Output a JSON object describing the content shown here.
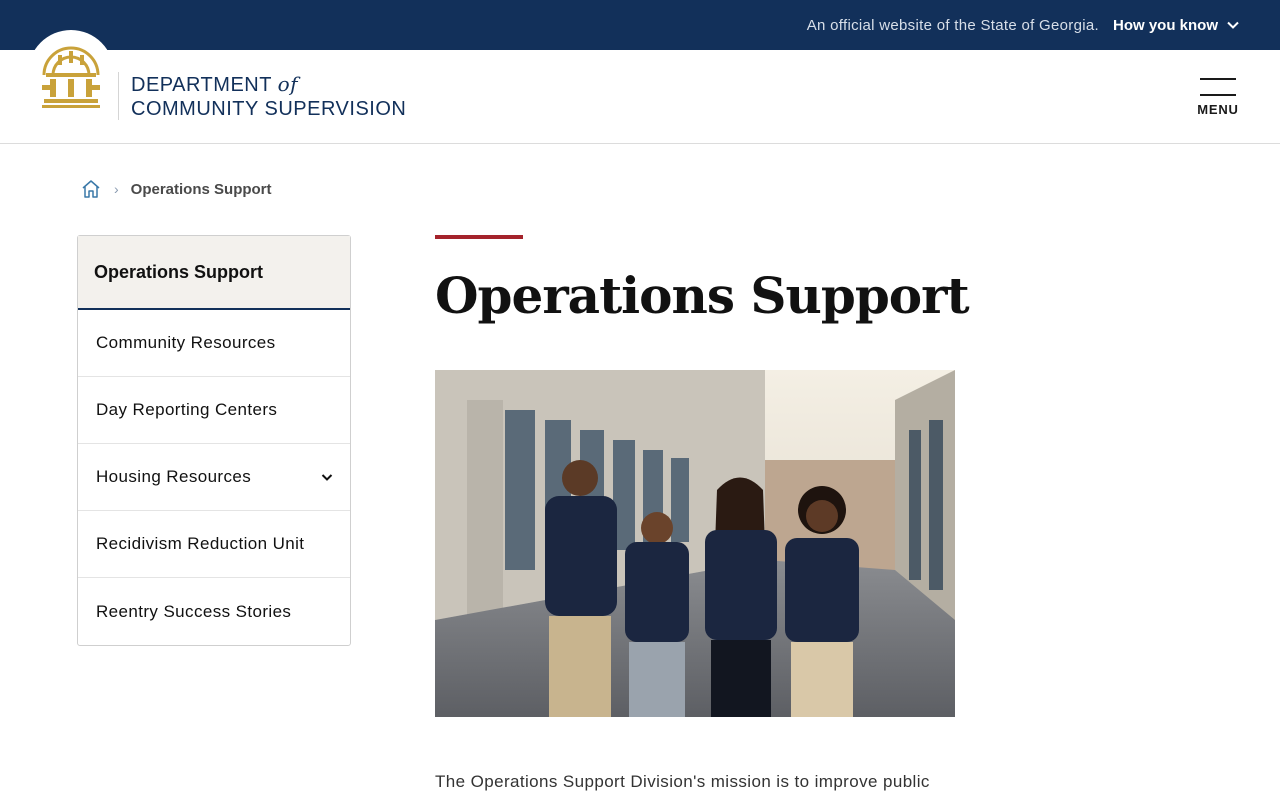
{
  "banner": {
    "official_text": "An official website of the State of Georgia.",
    "how_you_know": "How you know"
  },
  "header": {
    "dept_line1_a": "DEPARTMENT",
    "dept_line1_of": "of",
    "dept_line2": "COMMUNITY SUPERVISION",
    "menu_label": "MENU"
  },
  "breadcrumb": {
    "current": "Operations Support"
  },
  "side_nav": {
    "heading": "Operations Support",
    "items": [
      {
        "label": "Community Resources",
        "has_children": false
      },
      {
        "label": "Day Reporting Centers",
        "has_children": false
      },
      {
        "label": "Housing Resources",
        "has_children": true
      },
      {
        "label": "Recidivism Reduction Unit",
        "has_children": false
      },
      {
        "label": "Reentry Success Stories",
        "has_children": false
      }
    ]
  },
  "main": {
    "title": "Operations Support",
    "intro": "The Operations Support Division's mission is to improve public"
  },
  "colors": {
    "banner_bg": "#12305a",
    "accent_red": "#a4232b",
    "seal_gold": "#c9a23a",
    "nav_head_bg": "#f3f1ed"
  }
}
